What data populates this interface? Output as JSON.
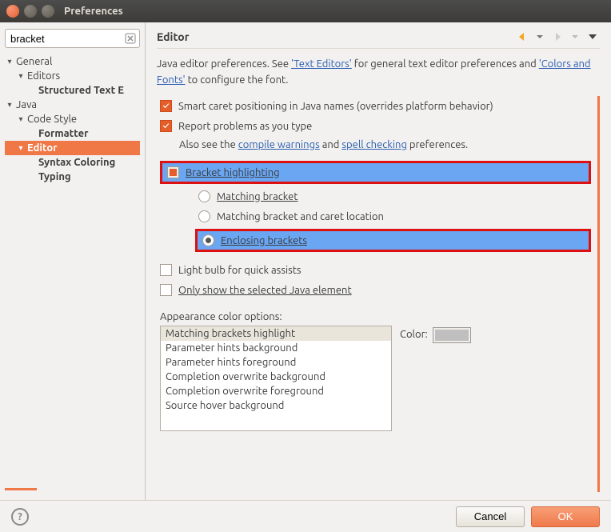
{
  "window": {
    "title": "Preferences"
  },
  "search": {
    "value": "bracket"
  },
  "tree": [
    {
      "label": "General",
      "level": 0,
      "expanded": true,
      "bold": false
    },
    {
      "label": "Editors",
      "level": 1,
      "expanded": true,
      "bold": false
    },
    {
      "label": "Structured Text E",
      "level": 2,
      "expanded": false,
      "bold": true
    },
    {
      "label": "Java",
      "level": 0,
      "expanded": true,
      "bold": false
    },
    {
      "label": "Code Style",
      "level": 1,
      "expanded": true,
      "bold": false
    },
    {
      "label": "Formatter",
      "level": 2,
      "expanded": false,
      "bold": true
    },
    {
      "label": "Editor",
      "level": 1,
      "expanded": true,
      "bold": true,
      "selected": true
    },
    {
      "label": "Syntax Coloring",
      "level": 2,
      "expanded": false,
      "bold": true
    },
    {
      "label": "Typing",
      "level": 2,
      "expanded": false,
      "bold": true
    }
  ],
  "header": {
    "title": "Editor"
  },
  "descr": {
    "prefix": "Java editor preferences. See ",
    "link1": "'Text Editors'",
    "mid": " for general text editor preferences and ",
    "link2": "'Colors and Fonts'",
    "suffix": " to configure the font."
  },
  "opts": {
    "smartCaret": "Smart caret positioning in Java names (overrides platform behavior)",
    "reportProblems": "Report problems as you type",
    "alsoSeePrefix": "Also see the ",
    "compileWarnings": "compile warnings",
    "alsoSeeMid": " and ",
    "spellChecking": "spell checking",
    "alsoSeeSuffix": " preferences.",
    "bracketHighlighting": "Bracket highlighting",
    "matchingBracket": "Matching bracket",
    "matchingBracketCaret": "Matching bracket and caret location",
    "enclosingBrackets": "Enclosing brackets",
    "lightBulb": "Light bulb for quick assists",
    "onlyShow": "Only show the selected Java element"
  },
  "colorSection": {
    "label": "Appearance color options:",
    "colorLabel": "Color:",
    "items": [
      "Matching brackets highlight",
      "Parameter hints background",
      "Parameter hints foreground",
      "Completion overwrite background",
      "Completion overwrite foreground",
      "Source hover background"
    ]
  },
  "footer": {
    "cancel": "Cancel",
    "ok": "OK"
  }
}
